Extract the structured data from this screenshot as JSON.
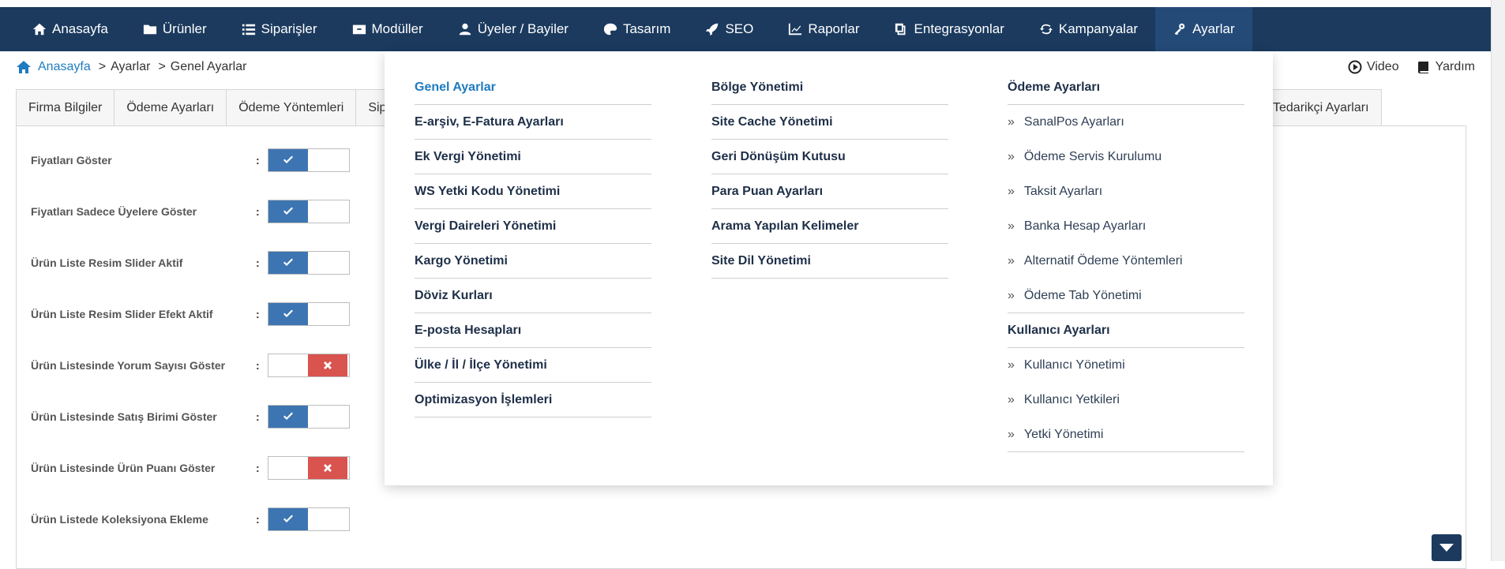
{
  "nav": {
    "items": [
      {
        "label": "Anasayfa",
        "icon": "home-icon"
      },
      {
        "label": "Ürünler",
        "icon": "folder-icon"
      },
      {
        "label": "Siparişler",
        "icon": "list-icon"
      },
      {
        "label": "Modüller",
        "icon": "box-icon"
      },
      {
        "label": "Üyeler / Bayiler",
        "icon": "user-icon"
      },
      {
        "label": "Tasarım",
        "icon": "palette-icon"
      },
      {
        "label": "SEO",
        "icon": "rocket-icon"
      },
      {
        "label": "Raporlar",
        "icon": "chart-icon"
      },
      {
        "label": "Entegrasyonlar",
        "icon": "copy-icon"
      },
      {
        "label": "Kampanyalar",
        "icon": "refresh-icon"
      },
      {
        "label": "Ayarlar",
        "icon": "keys-icon",
        "active": true
      }
    ]
  },
  "breadcrumb": {
    "home": "Anasayfa",
    "items": [
      "Ayarlar",
      "Genel Ayarlar"
    ]
  },
  "tools": {
    "video": "Video",
    "help": "Yardım"
  },
  "tabs": [
    "Firma Bilgiler",
    "Ödeme Ayarları",
    "Ödeme Yöntemleri",
    "Sip"
  ],
  "tab_right": "Tedarikçi Ayarları",
  "settings": [
    {
      "label": "Fiyatları Göster",
      "on": true
    },
    {
      "label": "Fiyatları Sadece Üyelere Göster",
      "on": true
    },
    {
      "label": "Ürün Liste Resim Slider Aktif",
      "on": true
    },
    {
      "label": "Ürün Liste Resim Slider Efekt Aktif",
      "on": true
    },
    {
      "label": "Ürün Listesinde Yorum Sayısı Göster",
      "on": false
    },
    {
      "label": "Ürün Listesinde Satış Birimi Göster",
      "on": true
    },
    {
      "label": "Ürün Listesinde Ürün Puanı Göster",
      "on": false
    },
    {
      "label": "Ürün Listede Koleksiyona Ekleme",
      "on": true
    }
  ],
  "colon": ":",
  "menu": {
    "col1": [
      "Genel Ayarlar",
      "E-arşiv, E-Fatura Ayarları",
      "Ek Vergi Yönetimi",
      "WS Yetki Kodu Yönetimi",
      "Vergi Daireleri Yönetimi",
      "Kargo Yönetimi",
      "Döviz Kurları",
      "E-posta Hesapları",
      "Ülke / İl / İlçe Yönetimi",
      "Optimizasyon İşlemleri"
    ],
    "col2": [
      "Bölge Yönetimi",
      "Site Cache Yönetimi",
      "Geri Dönüşüm Kutusu",
      "Para Puan Ayarları",
      "Arama Yapılan Kelimeler",
      "Site Dil Yönetimi"
    ],
    "col3_heading1": "Ödeme Ayarları",
    "col3_group1": [
      "SanalPos Ayarları",
      "Ödeme Servis Kurulumu",
      "Taksit Ayarları",
      "Banka Hesap Ayarları",
      "Alternatif Ödeme Yöntemleri",
      "Ödeme Tab Yönetimi"
    ],
    "col3_heading2": "Kullanıcı Ayarları",
    "col3_group2": [
      "Kullanıcı Yönetimi",
      "Kullanıcı Yetkileri",
      "Yetki Yönetimi"
    ]
  },
  "colors": {
    "nav_bg": "#1b3a5e",
    "accent": "#1f7bbf",
    "toggle_on": "#3d75b3",
    "toggle_off": "#d9534f"
  }
}
